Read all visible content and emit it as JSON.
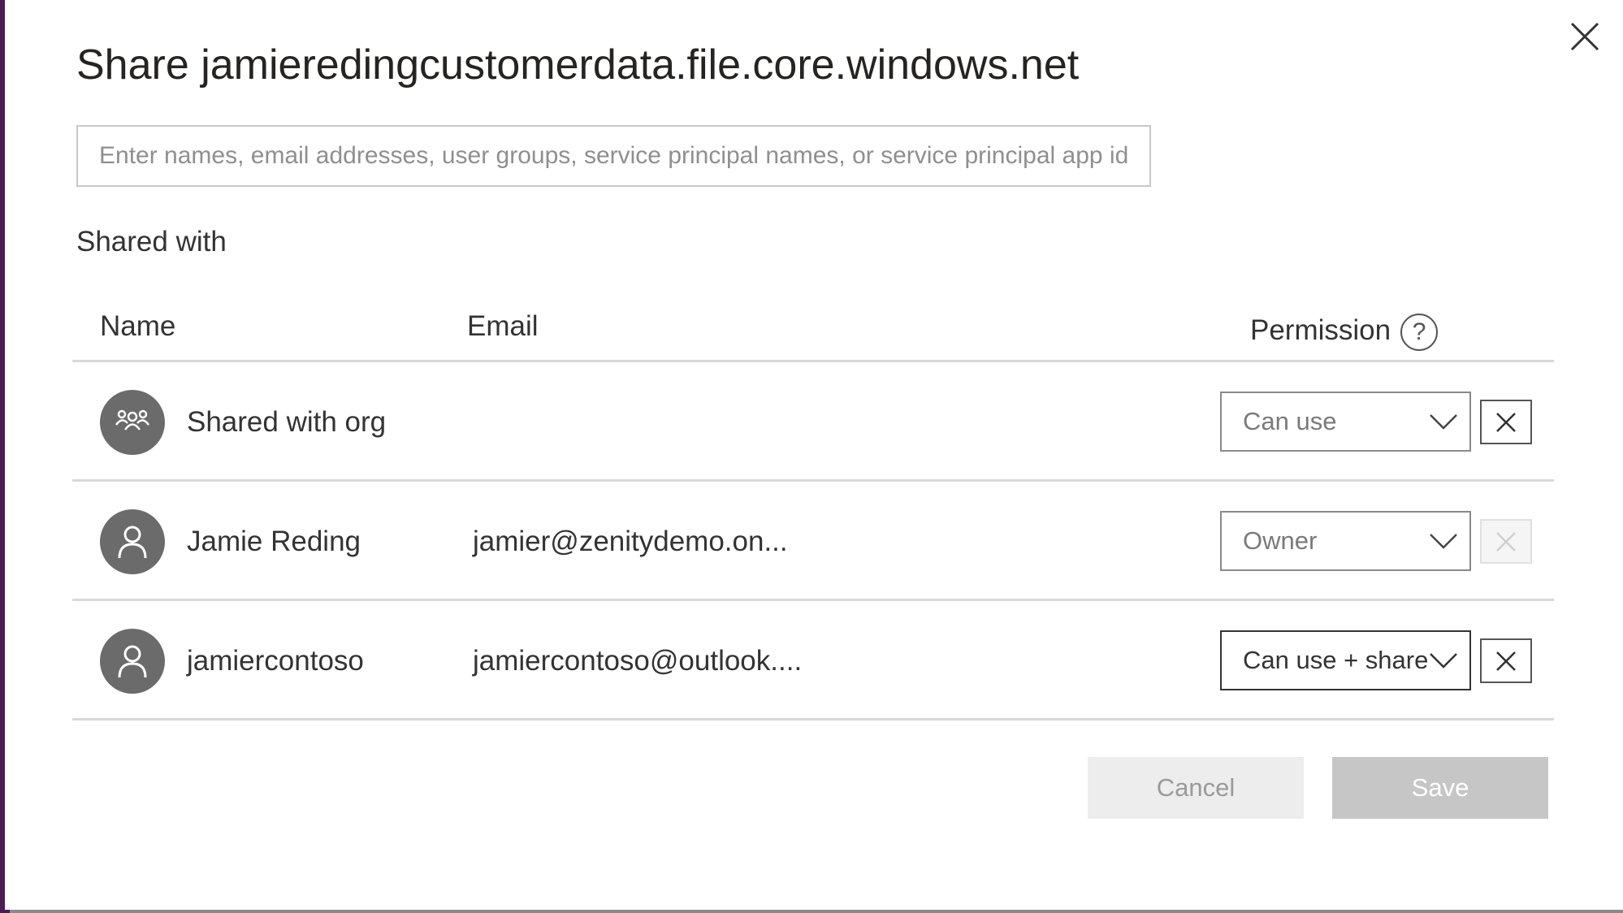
{
  "dialog": {
    "title": "Share jamieredingcustomerdata.file.core.windows.net",
    "search_placeholder": "Enter names, email addresses, user groups, service principal names, or service principal app id",
    "section_label": "Shared with"
  },
  "table": {
    "headers": {
      "name": "Name",
      "email": "Email",
      "permission": "Permission",
      "help": "?"
    },
    "rows": [
      {
        "name": "Shared with org",
        "email": "",
        "permission": "Can use",
        "avatar_icon": "group-icon",
        "removable": true
      },
      {
        "name": "Jamie Reding",
        "email": "jamier@zenitydemo.on...",
        "permission": "Owner",
        "avatar_icon": "person-icon",
        "removable": false
      },
      {
        "name": "jamiercontoso",
        "email": "jamiercontoso@outlook....",
        "permission": "Can use + share",
        "avatar_icon": "person-icon",
        "removable": true
      }
    ]
  },
  "buttons": {
    "cancel": "Cancel",
    "save": "Save"
  },
  "colors": {
    "backdrop_accent": "#4b1d52",
    "avatar_bg": "#6b6b6b",
    "save_disabled": "#c6c6c6"
  }
}
